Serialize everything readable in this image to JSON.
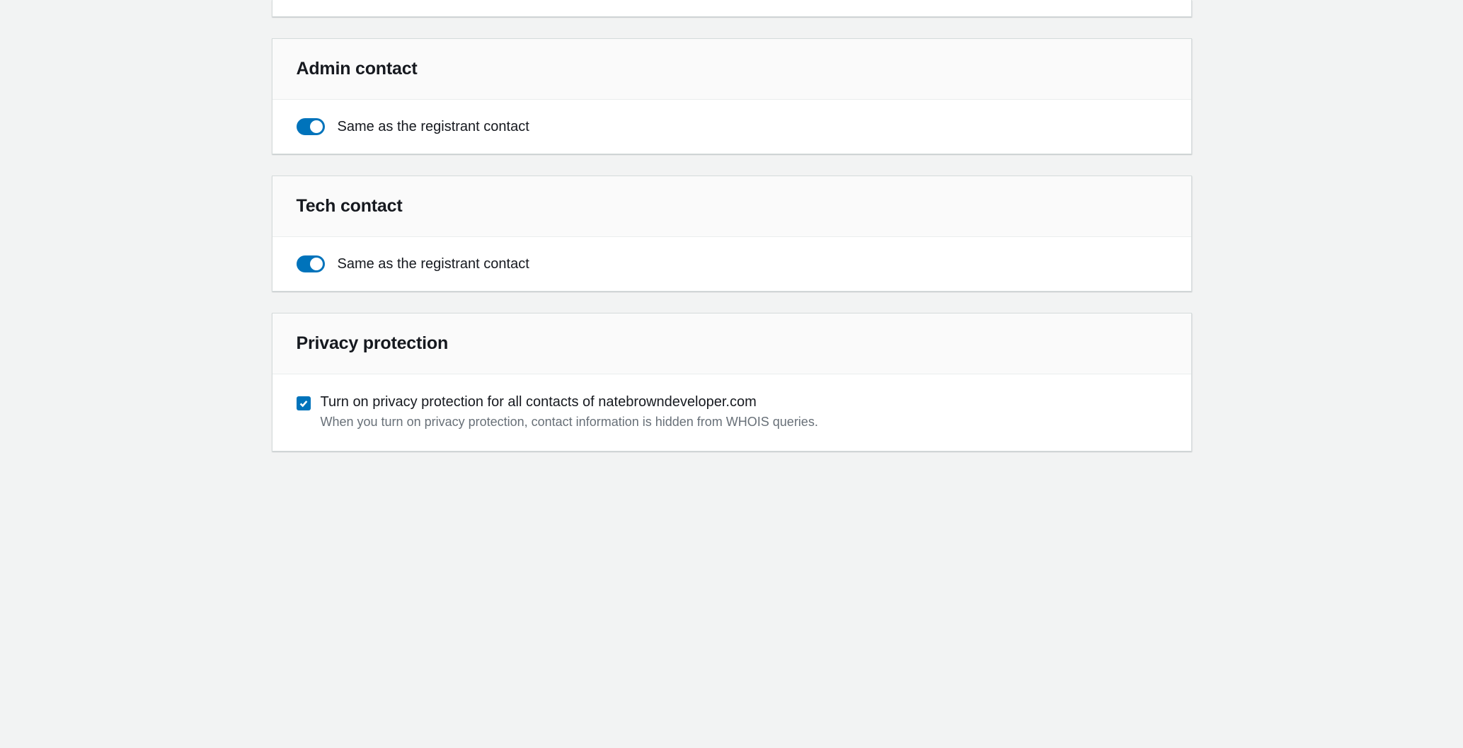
{
  "admin": {
    "title": "Admin contact",
    "toggleLabel": "Same as the registrant contact"
  },
  "tech": {
    "title": "Tech contact",
    "toggleLabel": "Same as the registrant contact"
  },
  "privacy": {
    "title": "Privacy protection",
    "checkboxLabel": "Turn on privacy protection for all contacts of natebrowndeveloper.com",
    "description": "When you turn on privacy protection, contact information is hidden from WHOIS queries."
  }
}
